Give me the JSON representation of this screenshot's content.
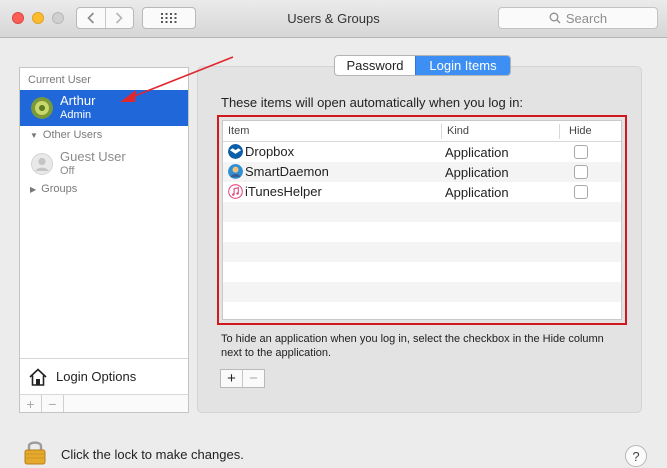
{
  "window": {
    "title": "Users & Groups",
    "search_placeholder": "Search",
    "back_icon": "chevron-left-icon",
    "forward_icon": "chevron-right-icon",
    "grid_icon": "grid-icon"
  },
  "sidebar": {
    "current_user_header": "Current User",
    "current_user": {
      "name": "Arthur",
      "role": "Admin"
    },
    "other_users_header": "Other Users",
    "guest_user": {
      "name": "Guest User",
      "status": "Off"
    },
    "groups_label": "Groups",
    "login_options_label": "Login Options",
    "add_label": "+",
    "remove_label": "−"
  },
  "tabs": [
    {
      "label": "Password",
      "selected": false
    },
    {
      "label": "Login Items",
      "selected": true
    }
  ],
  "login_items": {
    "intro": "These items will open automatically when you log in:",
    "columns": {
      "item": "Item",
      "kind": "Kind",
      "hide": "Hide"
    },
    "rows": [
      {
        "name": "Dropbox",
        "kind": "Application",
        "hide": false,
        "icon": "dropbox-icon"
      },
      {
        "name": "SmartDaemon",
        "kind": "Application",
        "hide": false,
        "icon": "smartdaemon-icon"
      },
      {
        "name": "iTunesHelper",
        "kind": "Application",
        "hide": false,
        "icon": "itunes-icon"
      }
    ],
    "hint": "To hide an application when you log in, select the checkbox in the Hide column next to the application.",
    "add_label": "+",
    "remove_label": "−"
  },
  "footer": {
    "lock_text": "Click the lock to make changes.",
    "help_label": "?"
  },
  "colors": {
    "selection": "#2067d9",
    "segment_active": "#3d8ff3",
    "highlight_box": "#d01a21",
    "annotation_arrow": "#e0262e"
  }
}
